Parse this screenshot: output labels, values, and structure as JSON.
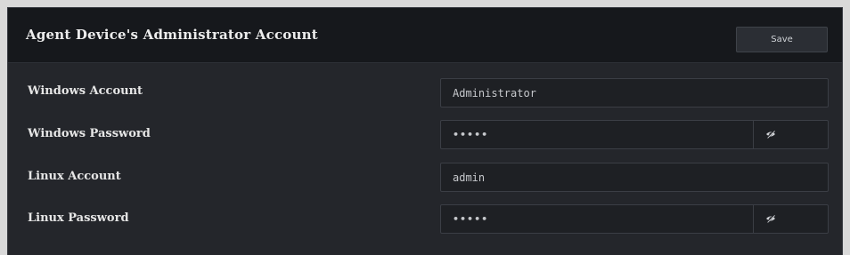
{
  "panel": {
    "title": "Agent Device's Administrator Account",
    "save_label": "Save"
  },
  "fields": [
    {
      "label": "Windows Account",
      "value": "Administrator",
      "type": "text"
    },
    {
      "label": "Windows Password",
      "value": "•••••",
      "type": "password",
      "toggle_icon": "eye-slash-icon"
    },
    {
      "label": "Linux Account",
      "value": "admin",
      "type": "text"
    },
    {
      "label": "Linux Password",
      "value": "•••••",
      "type": "password",
      "toggle_icon": "eye-slash-icon"
    }
  ]
}
